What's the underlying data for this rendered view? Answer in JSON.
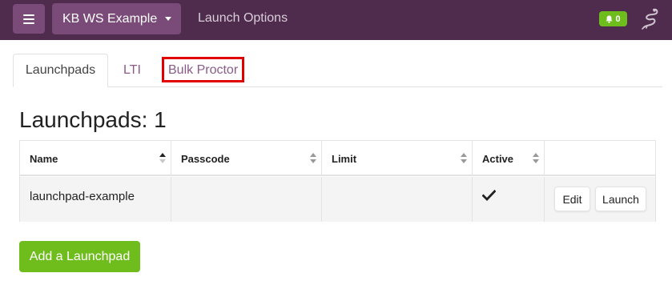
{
  "header": {
    "menu_icon": "hamburger-icon",
    "course_label": "KB WS Example",
    "nav_title": "Launch Options",
    "notification_count": "0",
    "notification_icon": "bell-icon",
    "logo_icon": "scorpion-logo-icon"
  },
  "tabs": [
    {
      "label": "Launchpads",
      "active": true
    },
    {
      "label": "LTI",
      "active": false
    },
    {
      "label": "Bulk Proctor",
      "active": false,
      "highlighted": true
    }
  ],
  "page_title": "Launchpads: 1",
  "table": {
    "columns": [
      {
        "label": "Name",
        "sort": "asc"
      },
      {
        "label": "Passcode",
        "sort": "none"
      },
      {
        "label": "Limit",
        "sort": "none"
      },
      {
        "label": "Active",
        "sort": "none"
      },
      {
        "label": "",
        "sort": null
      }
    ],
    "rows": [
      {
        "name": "launchpad-example",
        "passcode": "",
        "limit": "",
        "active": true,
        "actions": [
          "Edit",
          "Launch"
        ]
      }
    ]
  },
  "add_button_label": "Add a Launchpad",
  "colors": {
    "header_bg": "#4f2b4e",
    "header_button_bg": "#7a4a78",
    "accent_green": "#6ebd1d",
    "tab_link": "#8a5a88",
    "highlight_red": "#e00000"
  }
}
